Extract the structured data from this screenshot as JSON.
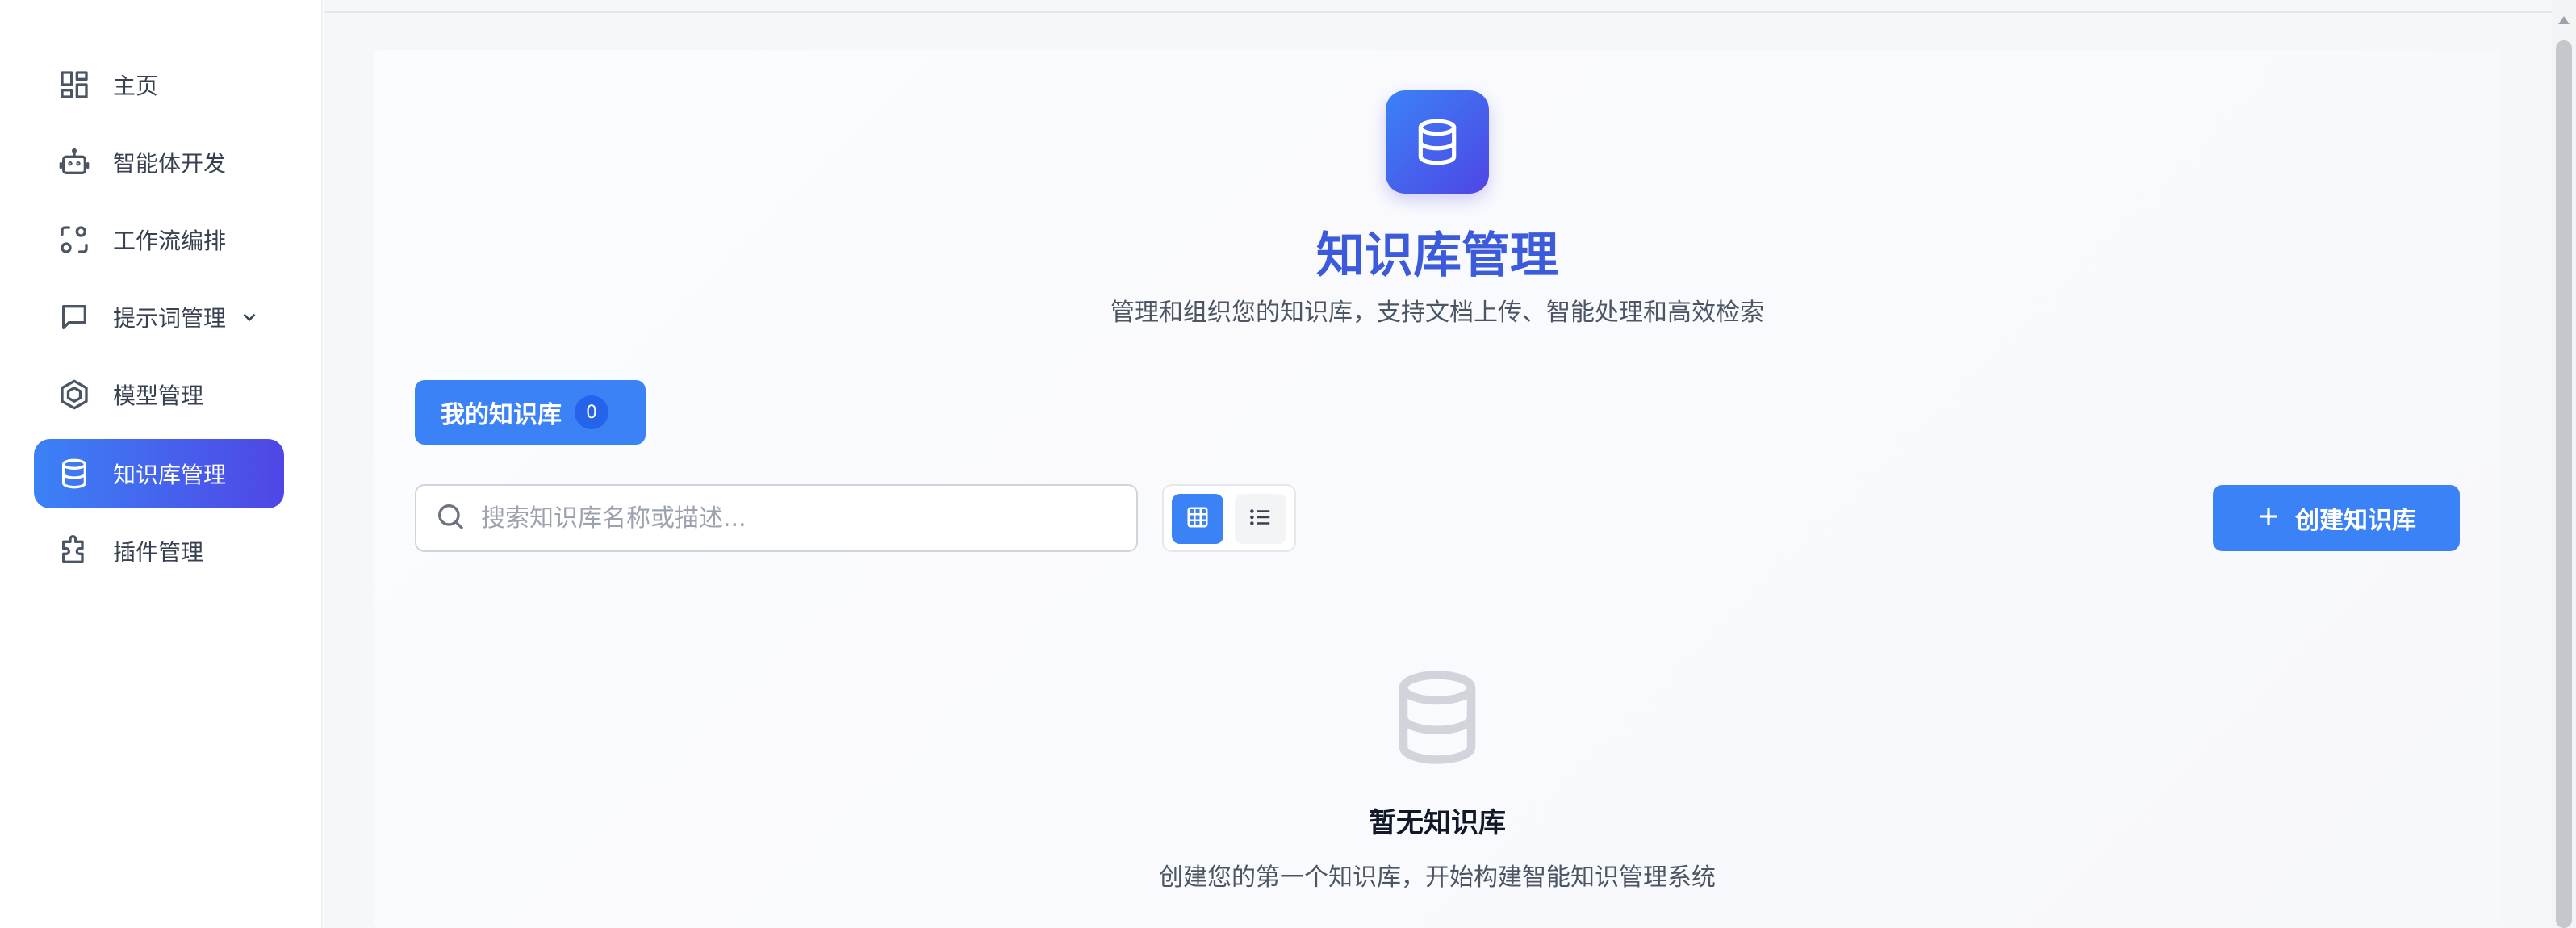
{
  "sidebar": {
    "items": [
      {
        "label": "主页",
        "icon": "dashboard-icon"
      },
      {
        "label": "智能体开发",
        "icon": "robot-icon"
      },
      {
        "label": "工作流编排",
        "icon": "workflow-icon"
      },
      {
        "label": "提示词管理",
        "icon": "chat-icon",
        "expandable": true
      },
      {
        "label": "模型管理",
        "icon": "model-icon"
      },
      {
        "label": "知识库管理",
        "icon": "database-icon",
        "active": true
      },
      {
        "label": "插件管理",
        "icon": "puzzle-icon"
      }
    ]
  },
  "header": {
    "title": "知识库管理",
    "subtitle": "管理和组织您的知识库，支持文档上传、智能处理和高效检索"
  },
  "tabs": [
    {
      "label": "我的知识库",
      "count": "0"
    }
  ],
  "search": {
    "placeholder": "搜索知识库名称或描述...",
    "value": ""
  },
  "view_toggle": {
    "selected": "grid",
    "options": [
      "grid",
      "list"
    ]
  },
  "create_button": {
    "label": "创建知识库"
  },
  "empty_state": {
    "title": "暂无知识库",
    "description": "创建您的第一个知识库，开始构建智能知识管理系统"
  },
  "colors": {
    "accent": "#3b82f6",
    "accent_gradient_end": "#4f46e5",
    "title": "#3b5bdb"
  }
}
